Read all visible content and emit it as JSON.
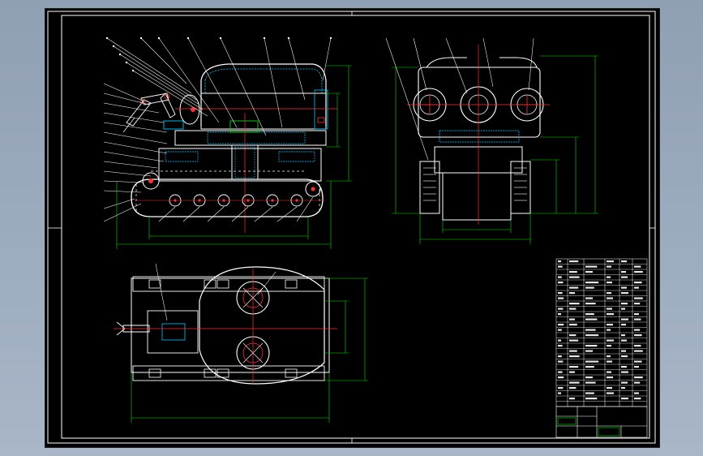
{
  "drawing": {
    "title_block_label": "",
    "technical_notes": [
      "",
      "",
      "",
      "",
      "",
      "",
      "",
      ""
    ]
  },
  "colors": {
    "background": "#000000",
    "frame": "#ffffff",
    "outline": "#ffffff",
    "dimension": "#00e000",
    "leader": "#ffffff",
    "centerline": "#ff3030",
    "hatch": "#00c8ff",
    "accent": "#ff3030"
  }
}
